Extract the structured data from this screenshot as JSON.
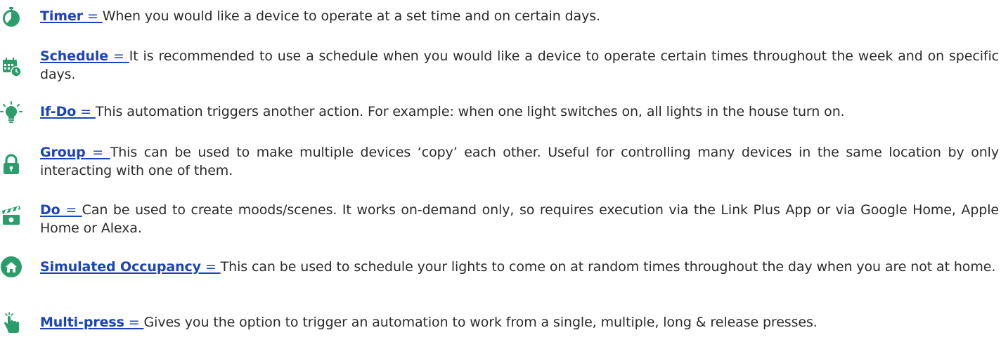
{
  "accent_color": "#1a44b8",
  "icon_color": "#2a9d6a",
  "items": [
    {
      "icon": "stopwatch-icon",
      "term": "Timer",
      "sep": " = ",
      "description": "When you would like a device to operate at a set time and on certain days."
    },
    {
      "icon": "calendar-clock-icon",
      "term": "Schedule",
      "sep": " = ",
      "description": "It is recommended to use a schedule when you would like a device to operate certain times throughout the week and on specific days."
    },
    {
      "icon": "lightbulb-icon",
      "term": "If-Do",
      "sep": " = ",
      "description": "This automation triggers another action. For example: when one light switches on, all lights in the house turn on."
    },
    {
      "icon": "lock-icon",
      "term": "Group",
      "sep": " = ",
      "description": "This can be used to make multiple devices ‘copy’ each other. Useful for controlling many devices in the same location by only interacting with one of them."
    },
    {
      "icon": "clapperboard-icon",
      "term": "Do",
      "sep": " = ",
      "description": "Can be used to create moods/scenes. It works on-demand only, so requires execution via the Link Plus App or via Google Home, Apple Home or Alexa."
    },
    {
      "icon": "home-icon",
      "term": "Simulated Occupancy",
      "sep": " = ",
      "description": "This can be used to schedule your lights to come on at random times throughout the day when you are not at home."
    },
    {
      "icon": "tap-hand-icon",
      "term": "Multi-press",
      "sep": " = ",
      "description": "Gives you the option to trigger an automation to work from a single, multiple, long & release presses."
    }
  ]
}
